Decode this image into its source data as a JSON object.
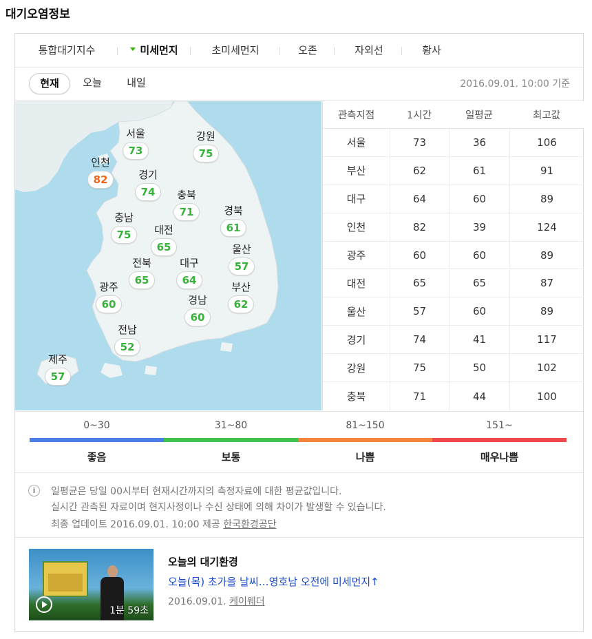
{
  "title": "대기오염정보",
  "tabs": [
    {
      "label": "통합대기지수"
    },
    {
      "label": "미세먼지"
    },
    {
      "label": "초미세먼지"
    },
    {
      "label": "오존"
    },
    {
      "label": "자외선"
    },
    {
      "label": "황사"
    }
  ],
  "active_tab": "미세먼지",
  "time_tabs": [
    {
      "label": "현재"
    },
    {
      "label": "오늘"
    },
    {
      "label": "내일"
    }
  ],
  "active_time_tab": "현재",
  "timestamp": "2016.09.01. 10:00 기준",
  "map": {
    "cities": [
      {
        "name": "서울",
        "value": "73"
      },
      {
        "name": "강원",
        "value": "75"
      },
      {
        "name": "인천",
        "value": "82"
      },
      {
        "name": "경기",
        "value": "74"
      },
      {
        "name": "충북",
        "value": "71"
      },
      {
        "name": "경북",
        "value": "61"
      },
      {
        "name": "충남",
        "value": "75"
      },
      {
        "name": "대전",
        "value": "65"
      },
      {
        "name": "울산",
        "value": "57"
      },
      {
        "name": "전북",
        "value": "65"
      },
      {
        "name": "대구",
        "value": "64"
      },
      {
        "name": "광주",
        "value": "60"
      },
      {
        "name": "부산",
        "value": "62"
      },
      {
        "name": "경남",
        "value": "60"
      },
      {
        "name": "전남",
        "value": "52"
      },
      {
        "name": "제주",
        "value": "57"
      }
    ]
  },
  "table": {
    "headers": [
      "관측지점",
      "1시간",
      "일평균",
      "최고값"
    ],
    "rows": [
      [
        "서울",
        "73",
        "36",
        "106"
      ],
      [
        "부산",
        "62",
        "61",
        "91"
      ],
      [
        "대구",
        "64",
        "60",
        "89"
      ],
      [
        "인천",
        "82",
        "39",
        "124"
      ],
      [
        "광주",
        "60",
        "60",
        "89"
      ],
      [
        "대전",
        "65",
        "65",
        "87"
      ],
      [
        "울산",
        "57",
        "60",
        "89"
      ],
      [
        "경기",
        "74",
        "41",
        "117"
      ],
      [
        "강원",
        "75",
        "50",
        "102"
      ],
      [
        "충북",
        "71",
        "44",
        "100"
      ]
    ]
  },
  "legend": [
    {
      "range": "0~30",
      "label": "좋음",
      "color": "#4a7fe8"
    },
    {
      "range": "31~80",
      "label": "보통",
      "color": "#3fc34a"
    },
    {
      "range": "81~150",
      "label": "나쁨",
      "color": "#f5843a"
    },
    {
      "range": "151~",
      "label": "매우나쁨",
      "color": "#ef4a4a"
    }
  ],
  "info": {
    "icon": "info-icon",
    "line1": "일평균은 당일 00시부터 현재시간까지의 측정자료에 대한 평균값입니다.",
    "line2": "실시간 관측된 자료이며 현지사정이나 수신 상태에 의해 차이가 발생할 수 있습니다.",
    "update_prefix": "최종 업데이트 2016.09.01. 10:00 제공",
    "provider": "한국환경공단"
  },
  "news": {
    "title": "오늘의 대기환경",
    "headline": "오늘(목) 초가을 날씨…영호남 오전에 미세먼지↑",
    "date": "2016.09.01.",
    "source": "케이웨더",
    "duration": "1분 59초"
  }
}
